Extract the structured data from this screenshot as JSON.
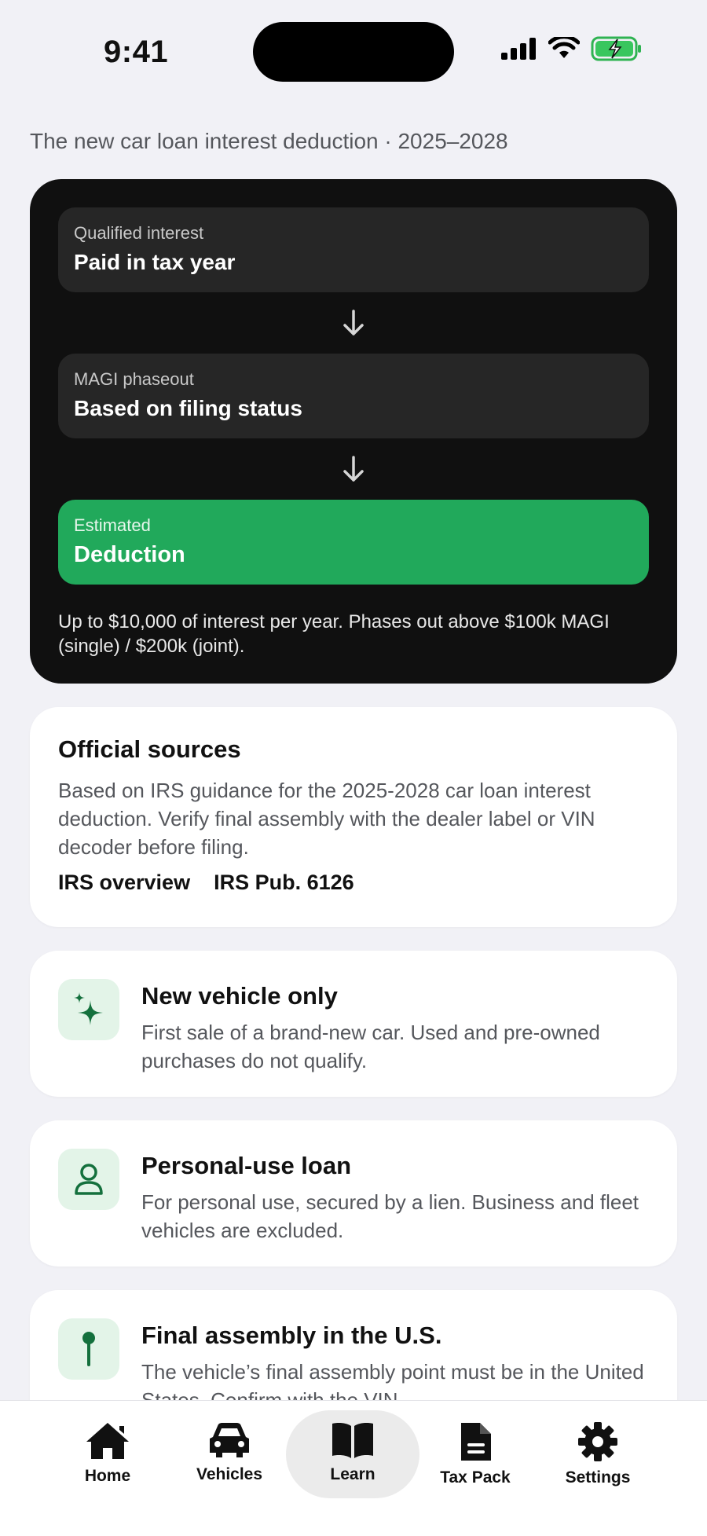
{
  "status_bar": {
    "time": "9:41"
  },
  "header": {
    "subtitle": "The new car loan interest deduction · 2025–2028"
  },
  "flow": {
    "steps": [
      {
        "label": "Qualified interest",
        "title": "Paid in tax year"
      },
      {
        "label": "MAGI phaseout",
        "title": "Based on filing status"
      },
      {
        "label": "Estimated",
        "title": "Deduction"
      }
    ],
    "note": "Up to $10,000 of interest per year. Phases out above $100k MAGI (single) / $200k (joint).",
    "accent_color": "#21a95b"
  },
  "sources": {
    "title": "Official sources",
    "body": "Based on IRS guidance for the 2025-2028 car loan interest deduction. Verify final assembly with the dealer label or VIN decoder before filing.",
    "links": [
      "IRS overview",
      "IRS Pub. 6126"
    ]
  },
  "features": [
    {
      "icon": "sparkles-icon",
      "title": "New vehicle only",
      "desc": "First sale of a brand-new car. Used and pre-owned purchases do not qualify."
    },
    {
      "icon": "person-icon",
      "title": "Personal-use loan",
      "desc": "For personal use, secured by a lien. Business and fleet vehicles are excluded."
    },
    {
      "icon": "pin-icon",
      "title": "Final assembly in the U.S.",
      "desc": "The vehicle’s final assembly point must be in the United States. Confirm with the VIN"
    }
  ],
  "tabs": [
    {
      "label": "Home",
      "icon": "house-icon"
    },
    {
      "label": "Vehicles",
      "icon": "car-icon"
    },
    {
      "label": "Learn",
      "icon": "book-icon",
      "active": true
    },
    {
      "label": "Tax Pack",
      "icon": "document-icon"
    },
    {
      "label": "Settings",
      "icon": "gear-icon"
    }
  ]
}
